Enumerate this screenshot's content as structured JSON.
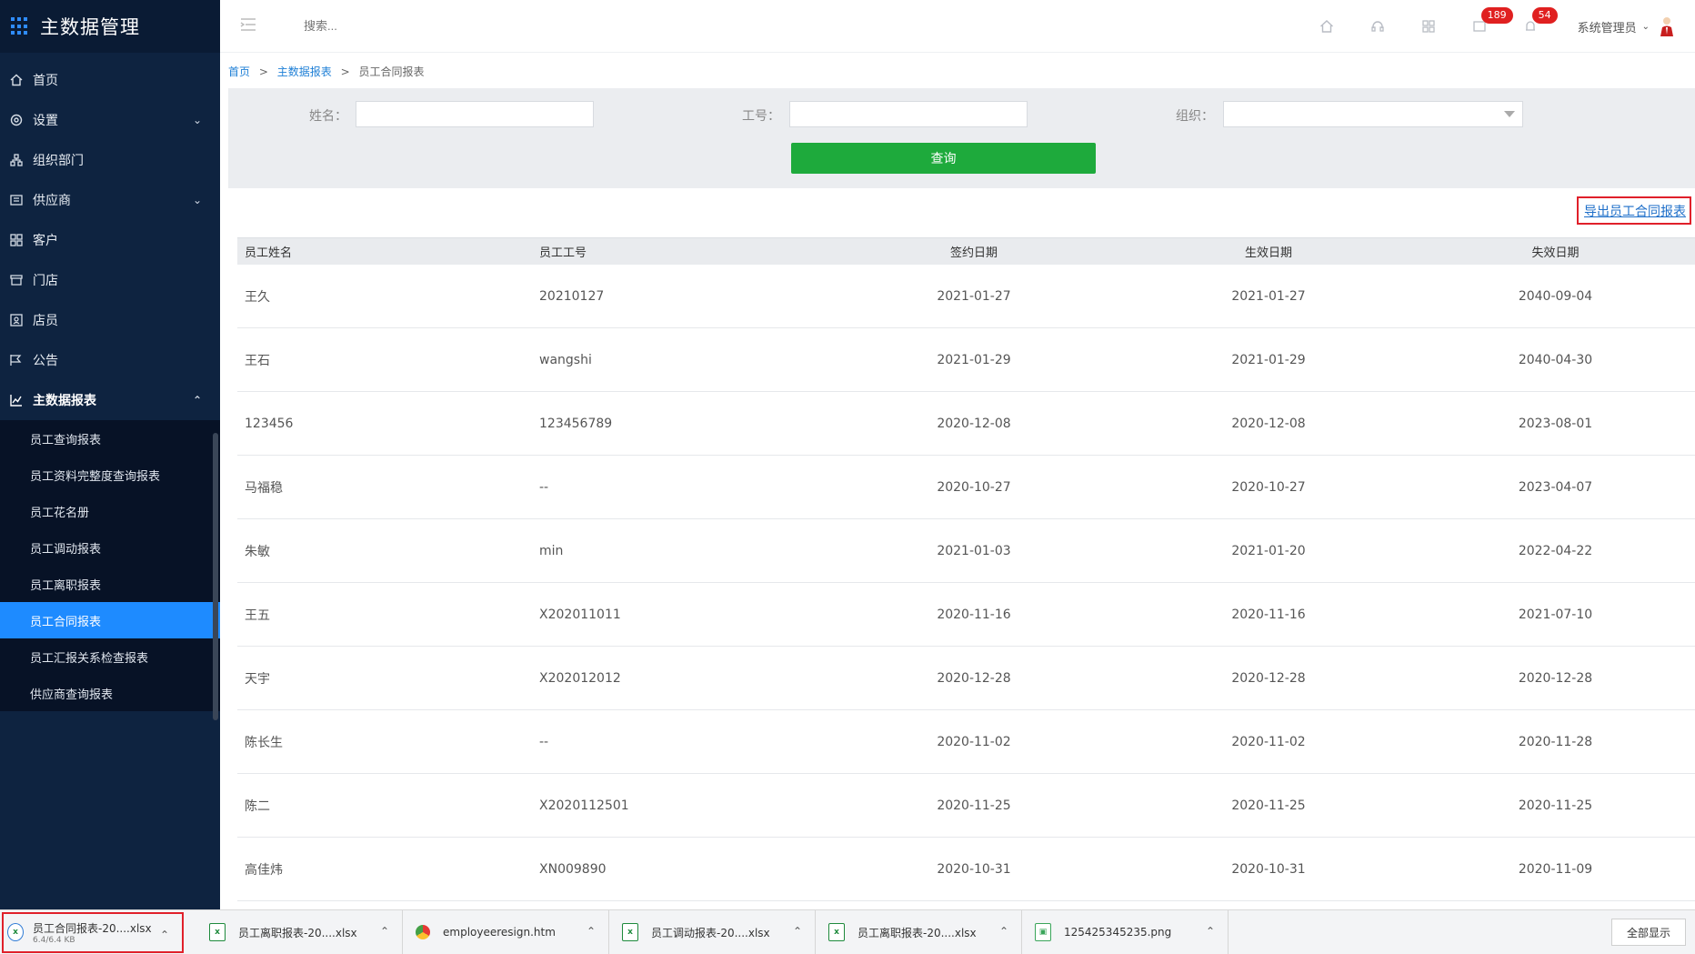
{
  "app": {
    "title": "主数据管理"
  },
  "header": {
    "search_placeholder": "搜索...",
    "badges": {
      "messages": "189",
      "notifications": "54"
    },
    "user": "系统管理员"
  },
  "sidebar": {
    "items": [
      {
        "label": "首页",
        "icon": "home-icon"
      },
      {
        "label": "设置",
        "icon": "settings-icon",
        "expandable": true
      },
      {
        "label": "组织部门",
        "icon": "org-icon"
      },
      {
        "label": "供应商",
        "icon": "supplier-icon",
        "expandable": true
      },
      {
        "label": "客户",
        "icon": "customer-icon"
      },
      {
        "label": "门店",
        "icon": "store-icon"
      },
      {
        "label": "店员",
        "icon": "clerk-icon"
      },
      {
        "label": "公告",
        "icon": "announcement-icon"
      },
      {
        "label": "主数据报表",
        "icon": "chart-icon",
        "expanded": true
      }
    ],
    "submenu": [
      "员工查询报表",
      "员工资料完整度查询报表",
      "员工花名册",
      "员工调动报表",
      "员工离职报表",
      "员工合同报表",
      "员工汇报关系检查报表",
      "供应商查询报表"
    ],
    "active_submenu": "员工合同报表"
  },
  "breadcrumb": {
    "home": "首页",
    "parent": "主数据报表",
    "current": "员工合同报表",
    "sep": ">"
  },
  "filter": {
    "name_label": "姓名：",
    "id_label": "工号：",
    "org_label": "组织：",
    "query_button": "查询"
  },
  "export_link": "导出员工合同报表",
  "table": {
    "columns": [
      "员工姓名",
      "员工工号",
      "签约日期",
      "生效日期",
      "失效日期"
    ],
    "rows": [
      [
        "王久",
        "20210127",
        "2021-01-27",
        "2021-01-27",
        "2040-09-04"
      ],
      [
        "王石",
        "wangshi",
        "2021-01-29",
        "2021-01-29",
        "2040-04-30"
      ],
      [
        "123456",
        "123456789",
        "2020-12-08",
        "2020-12-08",
        "2023-08-01"
      ],
      [
        "马福稳",
        "--",
        "2020-10-27",
        "2020-10-27",
        "2023-04-07"
      ],
      [
        "朱敏",
        "min",
        "2021-01-03",
        "2021-01-20",
        "2022-04-22"
      ],
      [
        "王五",
        "X202011011",
        "2020-11-16",
        "2020-11-16",
        "2021-07-10"
      ],
      [
        "天宇",
        "X202012012",
        "2020-12-28",
        "2020-12-28",
        "2020-12-28"
      ],
      [
        "陈长生",
        "--",
        "2020-11-02",
        "2020-11-02",
        "2020-11-28"
      ],
      [
        "陈二",
        "X2020112501",
        "2020-11-25",
        "2020-11-25",
        "2020-11-25"
      ],
      [
        "高佳炜",
        "XN009890",
        "2020-10-31",
        "2020-10-31",
        "2020-11-09"
      ]
    ]
  },
  "downloads": {
    "items": [
      {
        "name": "员工合同报表-20....xlsx",
        "sub": "6.4/6.4 KB",
        "type": "xlsx"
      },
      {
        "name": "员工离职报表-20....xlsx",
        "type": "xlsx"
      },
      {
        "name": "employeeresign.htm",
        "type": "chrome"
      },
      {
        "name": "员工调动报表-20....xlsx",
        "type": "xlsx"
      },
      {
        "name": "员工离职报表-20....xlsx",
        "type": "xlsx"
      },
      {
        "name": "125425345235.png",
        "type": "png"
      }
    ],
    "show_all": "全部显示"
  },
  "colors": {
    "sidebar_bg": "#0e2340",
    "active": "#1e8bff",
    "query_btn": "#1eaa3c",
    "badge": "#e02020",
    "highlight": "#e0202a"
  }
}
